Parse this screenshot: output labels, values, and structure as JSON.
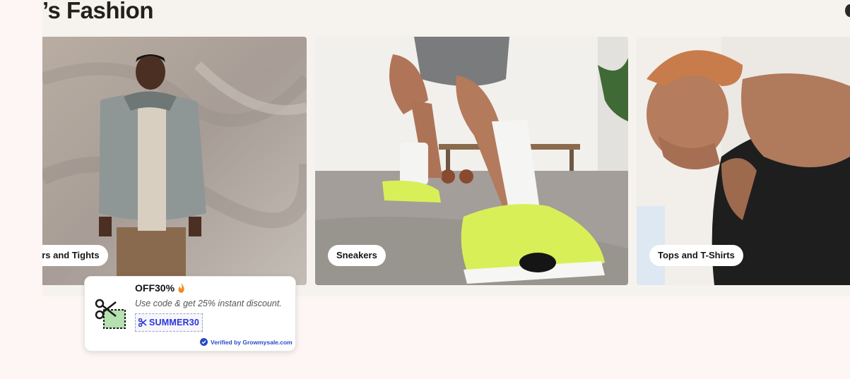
{
  "page": {
    "title": "’s Fashion"
  },
  "categories": [
    {
      "label": "ers and Tights",
      "image": "man-grey-hoodie-photo"
    },
    {
      "label": "Sneakers",
      "image": "neon-sneakers-photo"
    },
    {
      "label": "Tops and T-Shirts",
      "image": "athlete-tank-top-photo"
    }
  ],
  "coupon": {
    "title": "OFF30%",
    "description": "Use code & get 25% instant discount.",
    "code": "SUMMER30",
    "verified_text": "Verified by Growmysale.com",
    "icons": [
      "scissors-coupon-icon",
      "flame-icon",
      "scissors-small-icon",
      "verified-check-icon"
    ]
  },
  "colors": {
    "band": "#f6f3ee",
    "page": "#fdf6f4",
    "code": "#2a35d8",
    "verified": "#2b48c9",
    "neon": "#d8ef57"
  }
}
